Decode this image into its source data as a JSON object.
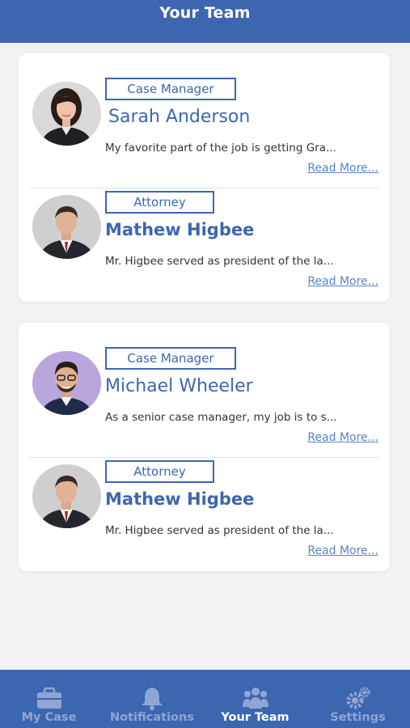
{
  "header": {
    "title": "Your Team"
  },
  "cards": [
    {
      "members": [
        {
          "role": "Case Manager",
          "name": "Sarah Anderson",
          "bio": "My favorite part of the job is getting Gra...",
          "read_more": "Read More..."
        },
        {
          "role": "Attorney",
          "name": "Mathew Higbee",
          "bio": "Mr. Higbee served as president of the la...",
          "read_more": "Read More..."
        }
      ]
    },
    {
      "members": [
        {
          "role": "Case Manager",
          "name": "Michael Wheeler",
          "bio": "As a senior case manager, my job is to s...",
          "read_more": "Read More..."
        },
        {
          "role": "Attorney",
          "name": "Mathew Higbee",
          "bio": "Mr. Higbee served as president of the la...",
          "read_more": "Read More..."
        }
      ]
    }
  ],
  "tabbar": {
    "tabs": [
      {
        "label": "My Case",
        "icon": "briefcase-icon"
      },
      {
        "label": "Notifications",
        "icon": "bell-icon"
      },
      {
        "label": "Your Team",
        "icon": "people-icon",
        "active": true
      },
      {
        "label": "Settings",
        "icon": "gears-icon"
      }
    ]
  },
  "colors": {
    "primary": "#3d66b0",
    "inactive_tab": "#8ea6d4",
    "background": "#f2f2f4"
  }
}
